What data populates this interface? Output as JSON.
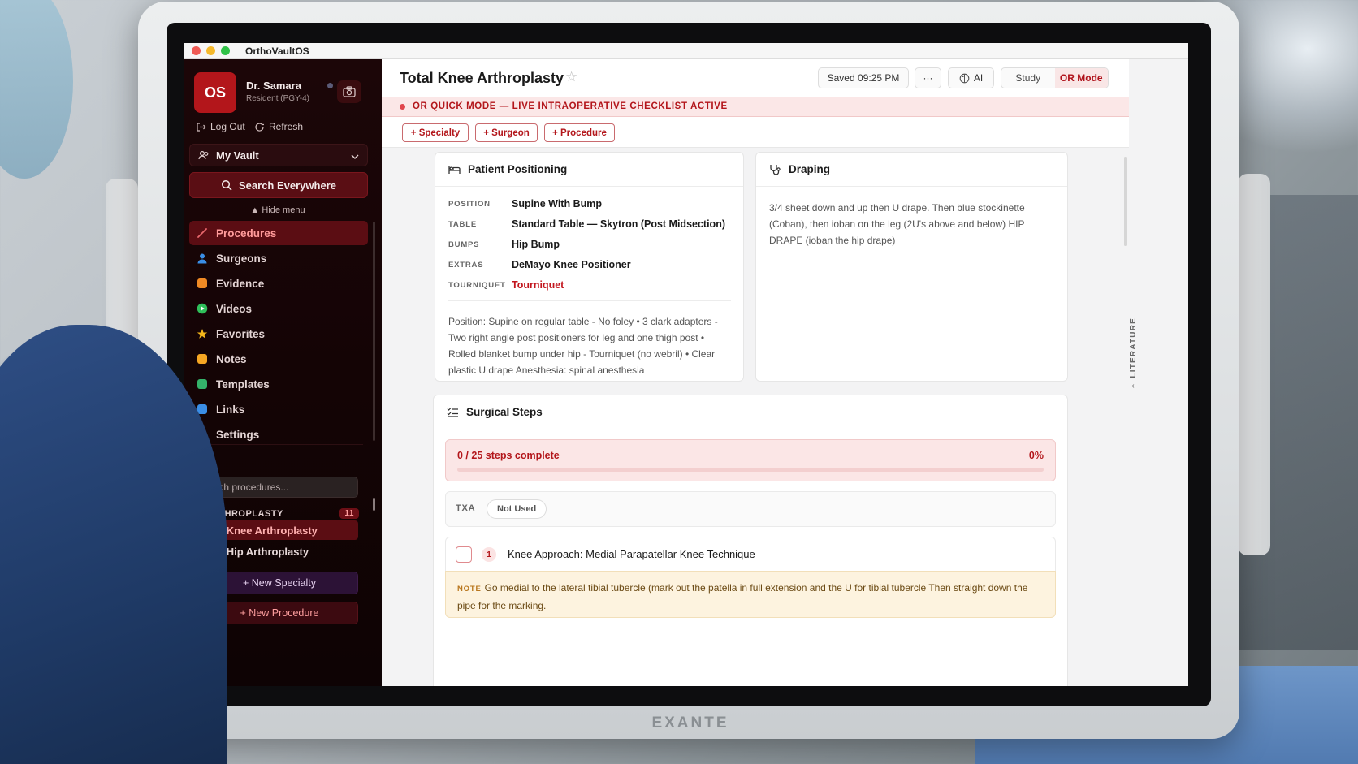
{
  "device": {
    "brand": "EXANTE"
  },
  "window": {
    "app_title": "OrthoVaultOS"
  },
  "sidebar": {
    "avatar_initials": "OS",
    "user_name": "Dr. Samara",
    "user_role": "Resident (PGY-4)",
    "logout_label": "Log Out",
    "refresh_label": "Refresh",
    "vault_label": "My Vault",
    "search_everywhere_label": "Search Everywhere",
    "hide_menu_label": "Hide menu",
    "nav": [
      {
        "label": "Procedures",
        "icon": "scalpel-icon",
        "color": "#e9686d"
      },
      {
        "label": "Surgeons",
        "icon": "person-icon",
        "color": "#3a8ee6"
      },
      {
        "label": "Evidence",
        "icon": "document-icon",
        "color": "#f08a24"
      },
      {
        "label": "Videos",
        "icon": "play-icon",
        "color": "#2fbf5a"
      },
      {
        "label": "Favorites",
        "icon": "star-icon",
        "color": "#f4b61a"
      },
      {
        "label": "Notes",
        "icon": "note-icon",
        "color": "#f5a623"
      },
      {
        "label": "Templates",
        "icon": "template-icon",
        "color": "#34b36a"
      },
      {
        "label": "Links",
        "icon": "link-icon",
        "color": "#3a8ee6"
      },
      {
        "label": "Settings",
        "icon": "gear-icon",
        "color": "#8b7cf6"
      }
    ],
    "procedure_search_placeholder": "Search procedures...",
    "category": {
      "name": "ARTHROPLASTY",
      "count": "11"
    },
    "procedures": [
      "Total Knee Arthroplasty",
      "Total Hip Arthroplasty"
    ],
    "new_specialty_label": "+ New Specialty",
    "new_procedure_label": "+ New Procedure"
  },
  "header": {
    "title": "Total Knee Arthroplasty",
    "saved_label": "Saved 09:25 PM",
    "more_label": "···",
    "ai_label": "AI",
    "study_label": "Study",
    "or_mode_label": "OR Mode"
  },
  "banner": {
    "text": "OR QUICK MODE — LIVE INTRAOPERATIVE CHECKLIST ACTIVE"
  },
  "tags": {
    "specialty": "+ Specialty",
    "surgeon": "+ Surgeon",
    "procedure": "+ Procedure"
  },
  "positioning": {
    "title": "Patient Positioning",
    "rows": [
      {
        "key": "POSITION",
        "value": "Supine With Bump"
      },
      {
        "key": "TABLE",
        "value": "Standard Table — Skytron (Post Midsection)"
      },
      {
        "key": "BUMPS",
        "value": "Hip Bump"
      },
      {
        "key": "EXTRAS",
        "value": "DeMayo Knee Positioner"
      },
      {
        "key": "TOURNIQUET",
        "value": "Tourniquet"
      }
    ],
    "note": "Position: Supine on regular table - No foley • 3 clark adapters - Two right angle post positioners for leg and one thigh post • Rolled blanket bump under hip - Tourniquet (no webril) • Clear plastic U drape Anesthesia: spinal anesthesia"
  },
  "draping": {
    "title": "Draping",
    "text": "3/4 sheet down and up then U drape. Then blue stockinette (Coban), then ioban on the leg (2U's above and below) HIP DRAPE (ioban the hip drape)"
  },
  "steps": {
    "title": "Surgical Steps",
    "progress_label": "0 / 25 steps complete",
    "progress_pct_label": "0%",
    "progress_fraction": 0,
    "txa_key": "TXA",
    "txa_value": "Not Used",
    "first_step": {
      "number": "1",
      "title": "Knee Approach: Medial Parapatellar Knee Technique",
      "note_tag": "NOTE",
      "note": "Go medial to the lateral tibial tubercle (mark out the patella in full extension and the U for tibial tubercle Then straight down the pipe for the marking."
    }
  },
  "literature_tab": {
    "label": "LITERATURE"
  }
}
